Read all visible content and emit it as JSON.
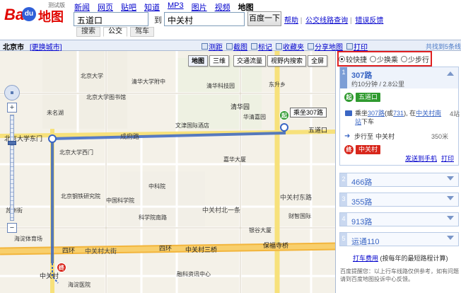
{
  "header": {
    "logo": {
      "bai": "Bai",
      "du": "du",
      "ditu": "地图",
      "beta": "测试版"
    },
    "nav": [
      "新闻",
      "网页",
      "贴吧",
      "知道",
      "MP3",
      "图片",
      "视频",
      "地图"
    ],
    "from_value": "五道口",
    "to_label": "到",
    "to_value": "中关村",
    "search_button": "百度一下",
    "links": {
      "help": "帮助",
      "bus_query": "公交线路查询",
      "report": "错误反馈"
    },
    "tabs": [
      "搜索",
      "公交",
      "驾车"
    ]
  },
  "toolbar": {
    "city": "北京市",
    "change_city": "[更换城市]",
    "tools": [
      "测距",
      "截图",
      "标记",
      "收藏夹",
      "分享地图",
      "打印"
    ],
    "found": "共找到5条线"
  },
  "map": {
    "buttons": [
      "地图",
      "三维",
      "交通流量",
      "视野内搜索",
      "全屏"
    ],
    "ride_tag": "乘坐307路",
    "start_pin": "起",
    "end_pin": "终",
    "labels": {
      "qinghuayuan": "清华园",
      "chengfu": "成府路",
      "wudaokou": "五道口",
      "pku_east_gate": "北京大学东门",
      "zhongguancun_east": "中关村东路",
      "zhongguancun_north": "中关村北一条",
      "zhongguancun_third": "中关村三桥",
      "sihuan": "四环",
      "baofu": "保福寺桥",
      "zhongguancun": "中关村",
      "zhongguancun_st": "中关村大街",
      "pku": "北京大学",
      "tsinghua_attached": "清华大学附中",
      "pku_lib": "北京大学图书馆",
      "tsinghua_tech": "清华科技园",
      "huaqing": "华清嘉园",
      "dongsheng": "东升乡",
      "haidian_hospital": "海淀医院",
      "zhongke": "中科院",
      "chinese_academy": "中国科学院",
      "academy_south": "科学院南路",
      "suzhou": "苏州街",
      "bjsteel": "北京钢铁研究院",
      "wenjin": "文津国际酒店",
      "jiashan": "嘉华大厦",
      "yinxing": "银谷大厦",
      "caizheng": "财智国际",
      "haidian_body": "海淀体育场",
      "ronghe": "融科资讯中心",
      "shida": "北京大学西门",
      "weiming": "未名湖"
    }
  },
  "panel": {
    "options": [
      "较快捷",
      "少换乘",
      "少步行"
    ],
    "selected_option": 0,
    "detail": {
      "index": "1",
      "route_name": "307路",
      "meta": "约10分钟 / 2.8公里",
      "start_label": "起",
      "start_stop": "五道口",
      "ride_prefix": "乘坐",
      "ride_line": "307路",
      "ride_alt_open": "(或",
      "ride_alt": "731",
      "ride_alt_close": "), 在",
      "ride_stop": "中关村南站",
      "ride_suffix": "下车",
      "stops": "4站",
      "walk_label": "步行至",
      "walk_target": "中关村",
      "walk_dist": "350米",
      "end_label": "终",
      "end_stop": "中关村",
      "send_phone": "发送到手机",
      "print": "打印"
    },
    "routes": [
      {
        "index": "2",
        "name": "466路"
      },
      {
        "index": "3",
        "name": "355路"
      },
      {
        "index": "4",
        "name": "913路"
      },
      {
        "index": "5",
        "name": "运通110"
      }
    ],
    "taxi_link": "打车费用",
    "taxi_note": "(按每年的最短路程计算)",
    "tip_line1": "百度提醒您：以上行车线路仅供参考，如有问题",
    "tip_line2": "请到百度地图投诉中心反馈。"
  }
}
